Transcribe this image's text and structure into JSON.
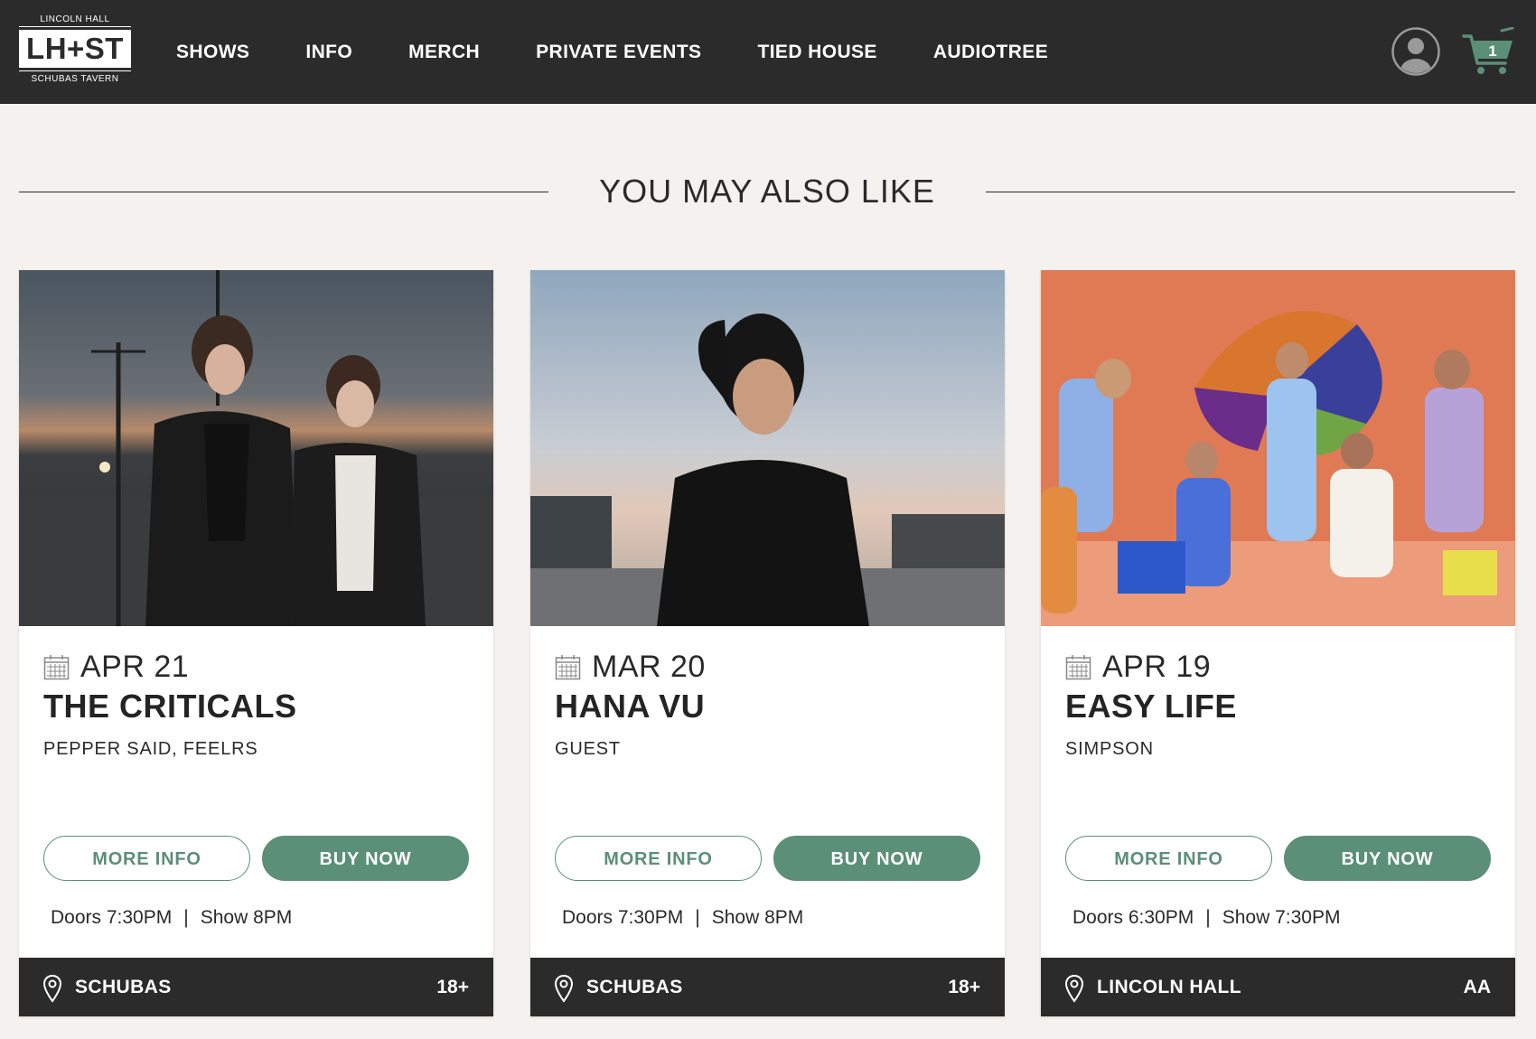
{
  "logo": {
    "top_text": "LINCOLN HALL",
    "mark": "LH+ST",
    "bottom_text": "SCHUBAS TAVERN"
  },
  "nav": {
    "items": [
      "SHOWS",
      "INFO",
      "MERCH",
      "PRIVATE EVENTS",
      "TIED HOUSE",
      "AUDIOTREE"
    ]
  },
  "header": {
    "cart_count": "1",
    "account_icon": "user-circle-icon",
    "cart_icon": "shopping-cart-icon"
  },
  "section": {
    "title": "YOU MAY ALSO LIKE"
  },
  "colors": {
    "accent": "#5b8f77",
    "dark_bar": "#2b2b2b",
    "page_bg": "#f5f1ee"
  },
  "cards": [
    {
      "date": "APR 21",
      "headliner": "THE CRITICALS",
      "support": "PEPPER SAID, FEELRS",
      "more_info": "MORE INFO",
      "buy_now": "BUY NOW",
      "doors": "Doors 7:30PM",
      "separator": "|",
      "show": "Show 8PM",
      "venue": "SCHUBAS",
      "age": "18+"
    },
    {
      "date": "MAR 20",
      "headliner": "HANA VU",
      "support": "GUEST",
      "more_info": "MORE INFO",
      "buy_now": "BUY NOW",
      "doors": "Doors 7:30PM",
      "separator": "|",
      "show": "Show 8PM",
      "venue": "SCHUBAS",
      "age": "18+"
    },
    {
      "date": "APR 19",
      "headliner": "EASY LIFE",
      "support": "SIMPSON",
      "more_info": "MORE INFO",
      "buy_now": "BUY NOW",
      "doors": "Doors 6:30PM",
      "separator": "|",
      "show": "Show 7:30PM",
      "venue": "LINCOLN HALL",
      "age": "AA"
    }
  ]
}
